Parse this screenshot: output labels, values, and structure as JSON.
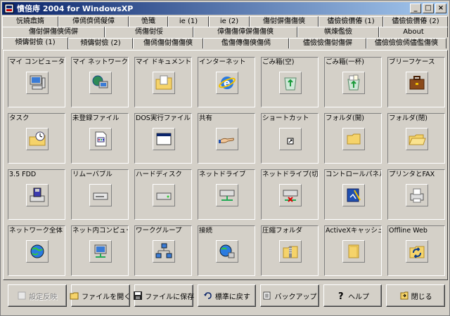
{
  "window": {
    "title": "憤倍庤 2004 for WindowsXP",
    "controls": [
      "_",
      "□",
      "×"
    ]
  },
  "tabs": {
    "row1": [
      "忨嬈嵞媠",
      "傽傿儕傿儗傽",
      "恑殱",
      "ie (1)",
      "ie (2)",
      "傷傠偋傷傷傸",
      "儘儉儉價偆 (1)",
      "儘儉儉價偆 (2)"
    ],
    "row2": [
      "傷傠偋傷傸傿偋",
      "傿傷傠俀",
      "傽傷傷傽偋傷傷傸",
      "帺煉儖儉",
      "About"
    ],
    "row3": [
      "傾儔傠儉 (1)",
      "傾儔傠儉 (2)",
      "傷傿傷傠傷傷傸",
      "儖傷傳傷傸傷傿",
      "儘儉儉傷傠傷偋",
      "儘儉儉儉傿儘儖傷傸"
    ]
  },
  "cells": [
    {
      "label": "マイ コンピュータ",
      "icon": "my-computer-icon"
    },
    {
      "label": "マイ ネットワーク",
      "icon": "my-network-icon"
    },
    {
      "label": "マイ ドキュメント",
      "icon": "my-documents-icon"
    },
    {
      "label": "インターネット",
      "icon": "internet-explorer-icon"
    },
    {
      "label": "ごみ箱(空)",
      "icon": "recycle-bin-empty-icon"
    },
    {
      "label": "ごみ箱(一杯)",
      "icon": "recycle-bin-full-icon"
    },
    {
      "label": "ブリーフケース",
      "icon": "briefcase-icon"
    },
    {
      "label": "タスク",
      "icon": "scheduled-task-icon"
    },
    {
      "label": "未登録ファイル",
      "icon": "unregistered-file-icon"
    },
    {
      "label": "DOS実行ファイル",
      "icon": "dos-executable-icon"
    },
    {
      "label": "共有",
      "icon": "shared-hand-icon"
    },
    {
      "label": "ショートカット",
      "icon": "shortcut-arrow-icon"
    },
    {
      "label": "フォルダ(開)",
      "icon": "folder-open-icon"
    },
    {
      "label": "フォルダ(閉)",
      "icon": "folder-closed-icon"
    },
    {
      "label": "3.5 FDD",
      "icon": "floppy-drive-icon"
    },
    {
      "label": "リムーバブル",
      "icon": "removable-drive-icon"
    },
    {
      "label": "ハードディスク",
      "icon": "hard-disk-icon"
    },
    {
      "label": "ネットドライブ",
      "icon": "network-drive-icon"
    },
    {
      "label": "ネットドライブ(切)",
      "icon": "network-drive-disconnected-icon"
    },
    {
      "label": "コントロールパネル",
      "icon": "control-panel-icon"
    },
    {
      "label": "プリンタとFAX",
      "icon": "printer-fax-icon"
    },
    {
      "label": "ネットワーク全体",
      "icon": "entire-network-icon"
    },
    {
      "label": "ネット内コンピュー",
      "icon": "network-computer-icon"
    },
    {
      "label": "ワークグループ",
      "icon": "workgroup-icon"
    },
    {
      "label": "接続",
      "icon": "connection-icon"
    },
    {
      "label": "圧縮フォルダ",
      "icon": "zip-folder-icon"
    },
    {
      "label": "ActiveXキャッシュ",
      "icon": "activex-cache-icon"
    },
    {
      "label": "Offline Web",
      "icon": "offline-web-icon"
    }
  ],
  "buttons": [
    {
      "label": "設定反映",
      "icon": "apply-icon",
      "disabled": true
    },
    {
      "label": "ファイルを開く",
      "icon": "open-file-icon",
      "disabled": false
    },
    {
      "label": "ファイルに保存",
      "icon": "save-file-icon",
      "disabled": false
    },
    {
      "label": "標準に戻す",
      "icon": "undo-icon",
      "disabled": false
    },
    {
      "label": "バックアップ",
      "icon": "backup-icon",
      "disabled": false
    },
    {
      "label": "ヘルプ",
      "icon": "help-icon",
      "disabled": false
    },
    {
      "label": "閉じる",
      "icon": "close-door-icon",
      "disabled": false
    }
  ]
}
